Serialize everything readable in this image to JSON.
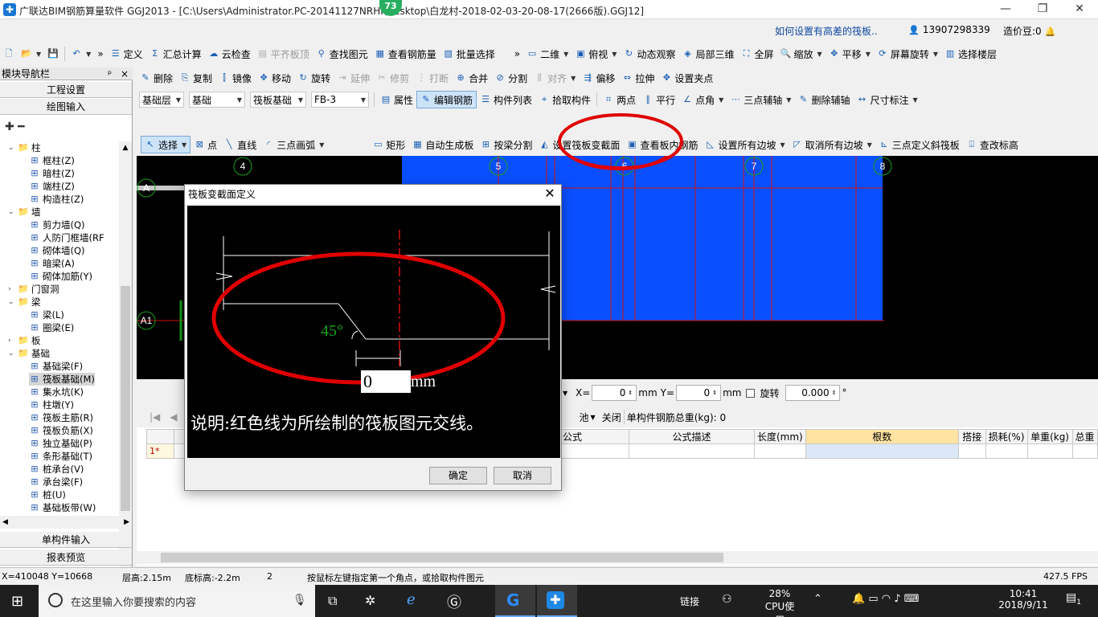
{
  "window": {
    "title": "广联达BIM钢筋算量软件 GGJ2013 - [C:\\Users\\Administrator.PC-20141127NRHI\\Desktop\\白龙村-2018-02-03-20-08-17(2666版).GGJ12]",
    "badge": "73",
    "controls": {
      "minimize": "—",
      "restore": "❐",
      "close": "✕"
    }
  },
  "header": {
    "help_link": "如何设置有高差的筏板..",
    "user": "13907298339",
    "bean_label": "造价豆:0"
  },
  "toolbar_main": [
    {
      "name": "define",
      "label": "定义",
      "icon": "define-icon"
    },
    {
      "name": "summary-calc",
      "label": "汇总计算",
      "icon": "sigma-icon"
    },
    {
      "name": "cloud-check",
      "label": "云检查",
      "icon": "cloud-icon"
    },
    {
      "name": "level-slab-top",
      "label": "平齐板顶",
      "icon": "slab-icon",
      "disabled": true
    },
    {
      "name": "find-element",
      "label": "查找图元",
      "icon": "binoculars-icon"
    },
    {
      "name": "view-rebar",
      "label": "查看钢筋量",
      "icon": "rebar-view-icon"
    },
    {
      "name": "batch-select",
      "label": "批量选择",
      "icon": "batch-icon"
    }
  ],
  "toolbar_view": [
    {
      "name": "view-2d",
      "label": "二维",
      "icon": "2d-icon",
      "dropdown": true
    },
    {
      "name": "top-view",
      "label": "俯视",
      "icon": "topview-icon",
      "dropdown": true
    },
    {
      "name": "dynamic-view",
      "label": "动态观察",
      "icon": "orbit-icon"
    },
    {
      "name": "local-3d",
      "label": "局部三维",
      "icon": "cube-icon"
    },
    {
      "name": "fullscreen",
      "label": "全屏",
      "icon": "fullscreen-icon"
    },
    {
      "name": "zoom",
      "label": "缩放",
      "icon": "zoom-icon",
      "dropdown": true
    },
    {
      "name": "pan",
      "label": "平移",
      "icon": "pan-icon",
      "dropdown": true
    },
    {
      "name": "rotate-screen",
      "label": "屏幕旋转",
      "icon": "rotate-screen-icon",
      "dropdown": true
    },
    {
      "name": "select-floor",
      "label": "选择楼层",
      "icon": "floor-icon"
    }
  ],
  "toolbar_edit": [
    {
      "name": "delete",
      "label": "删除",
      "icon": "pencil-icon"
    },
    {
      "name": "copy",
      "label": "复制",
      "icon": "copy-icon"
    },
    {
      "name": "mirror",
      "label": "镜像",
      "icon": "mirror-icon"
    },
    {
      "name": "move",
      "label": "移动",
      "icon": "move-icon"
    },
    {
      "name": "rotate",
      "label": "旋转",
      "icon": "rotate-icon"
    },
    {
      "name": "extend",
      "label": "延伸",
      "icon": "extend-icon",
      "disabled": true
    },
    {
      "name": "trim",
      "label": "修剪",
      "icon": "trim-icon",
      "disabled": true
    },
    {
      "name": "break",
      "label": "打断",
      "icon": "break-icon",
      "disabled": true
    },
    {
      "name": "merge",
      "label": "合并",
      "icon": "merge-icon"
    },
    {
      "name": "split",
      "label": "分割",
      "icon": "split-icon"
    },
    {
      "name": "align",
      "label": "对齐",
      "icon": "align-icon",
      "disabled": true,
      "dropdown": true
    },
    {
      "name": "offset",
      "label": "偏移",
      "icon": "offset-icon"
    },
    {
      "name": "stretch",
      "label": "拉伸",
      "icon": "stretch-icon"
    },
    {
      "name": "set-grip",
      "label": "设置夹点",
      "icon": "grip-icon"
    }
  ],
  "toolbar_layer": {
    "floor": "基础层",
    "category": "基础",
    "type": "筏板基础",
    "element": "FB-3",
    "buttons": [
      {
        "name": "properties",
        "label": "属性",
        "icon": "properties-icon"
      },
      {
        "name": "edit-rebar",
        "label": "编辑钢筋",
        "icon": "edit-rebar-icon",
        "active": true
      },
      {
        "name": "component-list",
        "label": "构件列表",
        "icon": "list-icon"
      },
      {
        "name": "pick-component",
        "label": "拾取构件",
        "icon": "pick-icon"
      }
    ],
    "aux": [
      {
        "name": "two-point",
        "label": "两点",
        "icon": "two-point-icon"
      },
      {
        "name": "parallel",
        "label": "平行",
        "icon": "parallel-icon"
      },
      {
        "name": "point-angle",
        "label": "点角",
        "icon": "point-angle-icon",
        "dropdown": true
      },
      {
        "name": "three-point-aux",
        "label": "三点辅轴",
        "icon": "three-point-icon",
        "dropdown": true
      },
      {
        "name": "delete-aux",
        "label": "删除辅轴",
        "icon": "delete-aux-icon"
      },
      {
        "name": "dimension",
        "label": "尺寸标注",
        "icon": "dimension-icon",
        "dropdown": true
      }
    ]
  },
  "toolbar_draw": [
    {
      "name": "select",
      "label": "选择",
      "icon": "cursor-icon",
      "dropdown": true,
      "active": true
    },
    {
      "name": "point",
      "label": "点",
      "icon": "point-icon"
    },
    {
      "name": "line",
      "label": "直线",
      "icon": "line-icon"
    },
    {
      "name": "three-point-arc",
      "label": "三点画弧",
      "icon": "arc-icon",
      "dropdown": true
    },
    {
      "name": "rectangle",
      "label": "矩形",
      "icon": "rectangle-icon"
    },
    {
      "name": "auto-generate-slab",
      "label": "自动生成板",
      "icon": "auto-slab-icon"
    },
    {
      "name": "split-by-beam",
      "label": "按梁分割",
      "icon": "split-beam-icon"
    },
    {
      "name": "set-raft-section",
      "label": "设置筏板变截面",
      "icon": "raft-section-icon"
    },
    {
      "name": "view-slab-rebar",
      "label": "查看板内钢筋",
      "icon": "slab-rebar-icon"
    },
    {
      "name": "set-all-slopes",
      "label": "设置所有边坡",
      "icon": "slope-icon",
      "dropdown": true
    },
    {
      "name": "cancel-all-slopes",
      "label": "取消所有边坡",
      "icon": "cancel-slope-icon",
      "dropdown": true
    },
    {
      "name": "three-point-slope",
      "label": "三点定义斜筏板",
      "icon": "slope-raft-icon"
    },
    {
      "name": "modify-elevation",
      "label": "查改标高",
      "icon": "elevation-icon"
    }
  ],
  "nav": {
    "title": "模块导航栏",
    "pin": "ᵖ",
    "close": "×",
    "top_buttons": [
      "工程设置",
      "绘图输入"
    ],
    "bottom_buttons": [
      "单构件输入",
      "报表预览"
    ],
    "tree": [
      {
        "label": "柱",
        "level": 0,
        "type": "folder",
        "expanded": true
      },
      {
        "label": "框柱(Z)",
        "level": 1,
        "type": "comp"
      },
      {
        "label": "暗柱(Z)",
        "level": 1,
        "type": "comp"
      },
      {
        "label": "端柱(Z)",
        "level": 1,
        "type": "comp"
      },
      {
        "label": "构造柱(Z)",
        "level": 1,
        "type": "comp"
      },
      {
        "label": "墙",
        "level": 0,
        "type": "folder",
        "expanded": true
      },
      {
        "label": "剪力墙(Q)",
        "level": 1,
        "type": "comp"
      },
      {
        "label": "人防门框墙(RF",
        "level": 1,
        "type": "comp"
      },
      {
        "label": "砌体墙(Q)",
        "level": 1,
        "type": "comp"
      },
      {
        "label": "暗梁(A)",
        "level": 1,
        "type": "comp"
      },
      {
        "label": "砌体加筋(Y)",
        "level": 1,
        "type": "comp"
      },
      {
        "label": "门窗洞",
        "level": 0,
        "type": "folder",
        "expanded": false
      },
      {
        "label": "梁",
        "level": 0,
        "type": "folder",
        "expanded": true
      },
      {
        "label": "梁(L)",
        "level": 1,
        "type": "comp"
      },
      {
        "label": "圈梁(E)",
        "level": 1,
        "type": "comp"
      },
      {
        "label": "板",
        "level": 0,
        "type": "folder",
        "expanded": false
      },
      {
        "label": "基础",
        "level": 0,
        "type": "folder",
        "expanded": true
      },
      {
        "label": "基础梁(F)",
        "level": 1,
        "type": "comp"
      },
      {
        "label": "筏板基础(M)",
        "level": 1,
        "type": "comp",
        "selected": true
      },
      {
        "label": "集水坑(K)",
        "level": 1,
        "type": "comp"
      },
      {
        "label": "柱墩(Y)",
        "level": 1,
        "type": "comp"
      },
      {
        "label": "筏板主筋(R)",
        "level": 1,
        "type": "comp"
      },
      {
        "label": "筏板负筋(X)",
        "level": 1,
        "type": "comp"
      },
      {
        "label": "独立基础(P)",
        "level": 1,
        "type": "comp"
      },
      {
        "label": "条形基础(T)",
        "level": 1,
        "type": "comp"
      },
      {
        "label": "桩承台(V)",
        "level": 1,
        "type": "comp"
      },
      {
        "label": "承台梁(F)",
        "level": 1,
        "type": "comp"
      },
      {
        "label": "桩(U)",
        "level": 1,
        "type": "comp"
      },
      {
        "label": "基础板带(W)",
        "level": 1,
        "type": "comp"
      }
    ]
  },
  "canvas": {
    "axis_labels": [
      "4",
      "5",
      "6",
      "7",
      "8"
    ],
    "row_labels": [
      "A",
      "A1"
    ]
  },
  "dialog": {
    "title": "筏板变截面定义",
    "close": "✕",
    "angle": "45°",
    "input_value": "0",
    "unit": "mm",
    "note": "说明:红色线为所绘制的筏板图元交线。",
    "ok": "确定",
    "cancel": "取消"
  },
  "coord_bar": {
    "x_label": "X=",
    "x_value": "0",
    "y_label": "Y=",
    "y_value": "0",
    "unit": "mm",
    "rotate_label": "旋转",
    "rotate_value": "0.000",
    "degree": "°"
  },
  "rebar_toolbar": {
    "items": [
      "池",
      "关闭"
    ],
    "total_label": "单构件钢筋总重(kg): 0"
  },
  "rebar_table": {
    "columns": [
      "公式",
      "公式描述",
      "长度(mm)",
      "根数",
      "搭接",
      "损耗(%)",
      "单重(kg)",
      "总重"
    ],
    "row_marker": "1*"
  },
  "status": {
    "coords": "X=410048 Y=10668",
    "floor_height": "层高:2.15m",
    "bottom_elev": "底标高:-2.2m",
    "count": "2",
    "hint": "按鼠标左键指定第一个角点，或拾取构件图元",
    "fps": "427.5 FPS"
  },
  "taskbar": {
    "search_placeholder": "在这里输入你要搜索的内容",
    "cpu_percent": "28%",
    "cpu_label": "CPU使用",
    "link_label": "链接",
    "time": "10:41",
    "date": "2018/9/11",
    "notification_count": "1"
  },
  "colors": {
    "slab_blue": "#0a4fff",
    "axis_red": "#d01010",
    "annotation_red": "#e00000",
    "axis_green": "#1aa01a"
  }
}
